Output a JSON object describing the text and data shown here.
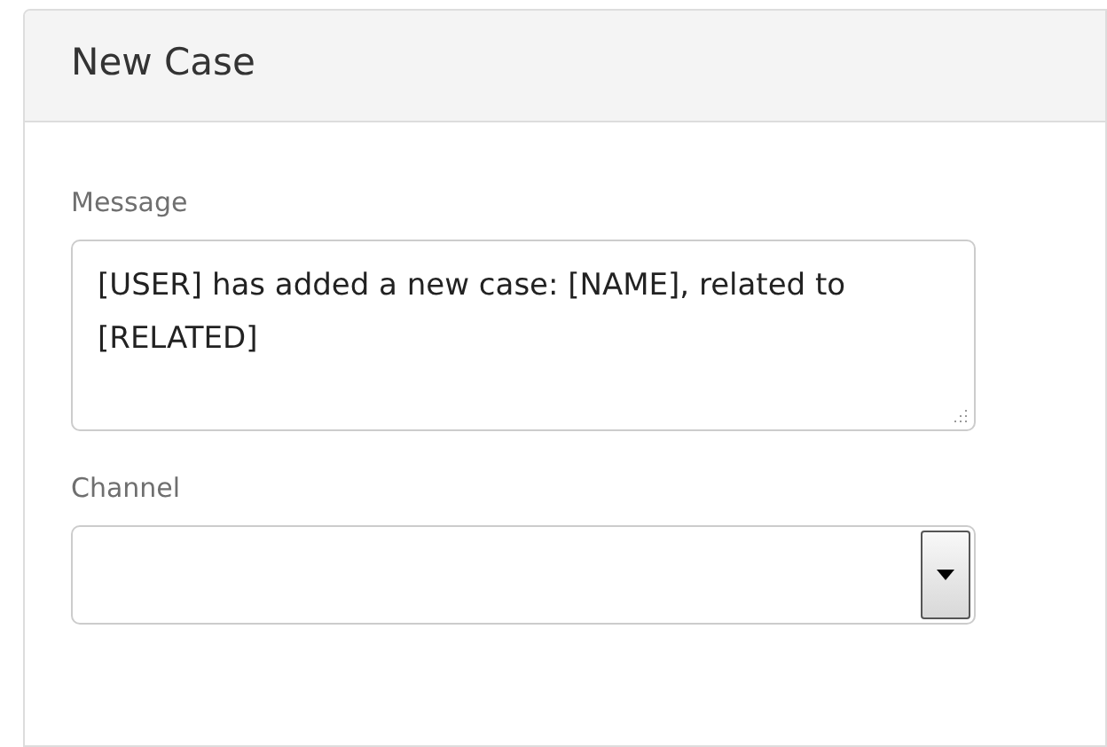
{
  "panel": {
    "title": "New Case",
    "fields": [
      {
        "kind": "textarea",
        "label": "Message",
        "value": "[USER] has added a new case: [NAME], related to [RELATED]"
      },
      {
        "kind": "select",
        "label": "Channel"
      }
    ]
  }
}
